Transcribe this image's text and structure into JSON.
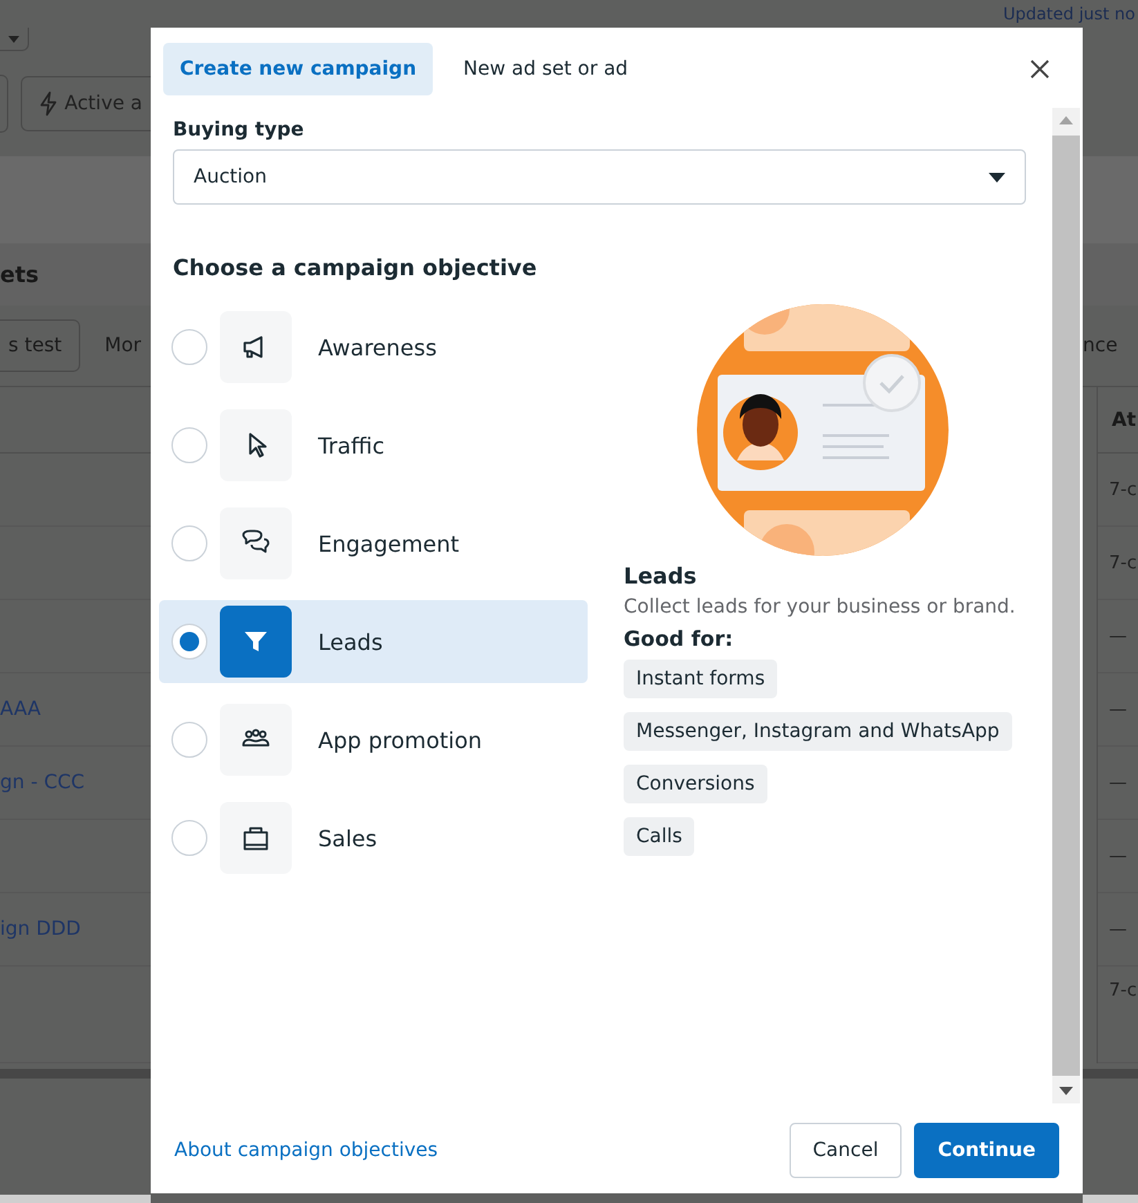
{
  "background": {
    "status_text": "Updated just no",
    "toolbar_button": "Active a",
    "section_title": "ets",
    "filter_buttons": [
      "s test",
      "Mor"
    ],
    "right_filter": "nce",
    "column_header": "At",
    "rows": [
      {
        "right": "7-c"
      },
      {
        "right": "7-c"
      },
      {
        "right": "—"
      },
      {
        "left": "AAA",
        "right": "—"
      },
      {
        "left": "gn - CCC",
        "right": "—"
      },
      {
        "right": "—"
      },
      {
        "left": "ign DDD",
        "right": "—"
      },
      {
        "right": "7-c"
      }
    ]
  },
  "modal": {
    "tabs": [
      {
        "label": "Create new campaign",
        "selected": true
      },
      {
        "label": "New ad set or ad",
        "selected": false
      }
    ],
    "buying_type": {
      "label": "Buying type",
      "value": "Auction"
    },
    "objective_heading": "Choose a campaign objective",
    "objectives": [
      {
        "label": "Awareness",
        "selected": false
      },
      {
        "label": "Traffic",
        "selected": false
      },
      {
        "label": "Engagement",
        "selected": false
      },
      {
        "label": "Leads",
        "selected": true
      },
      {
        "label": "App promotion",
        "selected": false
      },
      {
        "label": "Sales",
        "selected": false
      }
    ],
    "detail": {
      "title": "Leads",
      "description": "Collect leads for your business or brand.",
      "good_for_label": "Good for:",
      "chips": [
        "Instant forms",
        "Messenger, Instagram and WhatsApp",
        "Conversions",
        "Calls"
      ]
    },
    "footer": {
      "link": "About campaign objectives",
      "buttons": [
        {
          "label": "Cancel",
          "kind": "secondary"
        },
        {
          "label": "Continue",
          "kind": "primary"
        }
      ]
    }
  }
}
